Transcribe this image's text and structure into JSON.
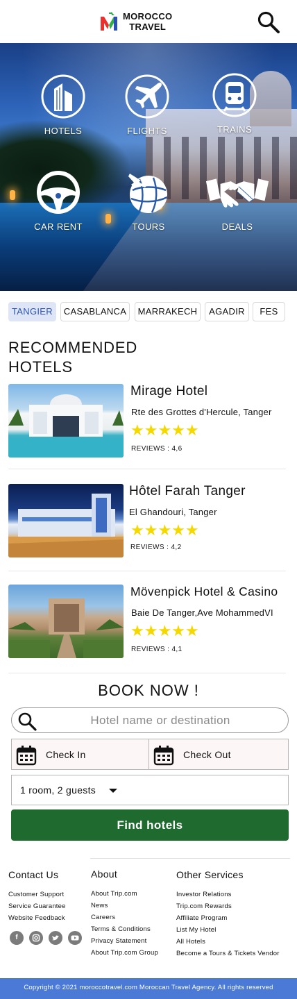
{
  "brand": {
    "name_line1": "MOROCCO",
    "name_line2": "TRAVEL",
    "colors": {
      "red": "#e8322d",
      "green": "#2fae4a",
      "blue": "#2b4fb5"
    }
  },
  "header": {
    "search_icon": "search-icon"
  },
  "categories": [
    {
      "label": "HOTELS",
      "icon": "building-icon"
    },
    {
      "label": "FLIGHTS",
      "icon": "plane-icon"
    },
    {
      "label": "TRAINS",
      "icon": "train-icon"
    },
    {
      "label": "CAR RENT",
      "icon": "steering-wheel-icon"
    },
    {
      "label": "TOURS",
      "icon": "globe-plane-icon"
    },
    {
      "label": "DEALS",
      "icon": "handshake-icon"
    }
  ],
  "cities": [
    {
      "label": "TANGIER",
      "active": true
    },
    {
      "label": "CASABLANCA",
      "active": false
    },
    {
      "label": "MARRAKECH",
      "active": false
    },
    {
      "label": "AGADIR",
      "active": false
    },
    {
      "label": "FES",
      "active": false
    }
  ],
  "section_title": "RECOMMENDED HOTELS",
  "hotels": [
    {
      "name": "Mirage Hotel",
      "address": "Rte des Grottes d'Hercule, Tanger",
      "stars": "★★★★★",
      "rating": 5,
      "reviews_label": "REVIEWS :",
      "reviews_value": "4,6"
    },
    {
      "name": "Hôtel Farah Tanger",
      "address": "El Ghandouri, Tanger",
      "stars": "★★★★★",
      "rating": 5,
      "reviews_label": "REVIEWS :",
      "reviews_value": "4,2"
    },
    {
      "name": "Mövenpick Hotel & Casino",
      "address": "Baie De Tanger,Ave MohammedVI",
      "stars": "★★★★★",
      "rating": 5,
      "reviews_label": "REVIEWS :",
      "reviews_value": "4,1"
    }
  ],
  "booking": {
    "title": "BOOK NOW !",
    "search_placeholder": "Hotel name or destination",
    "check_in": "Check In",
    "check_out": "Check Out",
    "guests": "1 room, 2 guests",
    "find_button": "Find hotels",
    "button_color": "#1f6b2f"
  },
  "footer": {
    "contact": {
      "title": "Contact Us",
      "links": [
        "Customer Support",
        "Service Guarantee",
        "Website Feedback"
      ]
    },
    "about": {
      "title": "About",
      "links": [
        "About Trip.com",
        "News",
        "Careers",
        "Terms & Conditions",
        "Privacy Statement",
        "About Trip.com Group"
      ]
    },
    "other": {
      "title": "Other Services",
      "links": [
        "Investor Relations",
        "Trip.com Rewards",
        "Affiliate Program",
        "List My Hotel",
        "All Hotels",
        "Become a Tours & Tickets Vendor"
      ]
    },
    "social": [
      "facebook-icon",
      "instagram-icon",
      "twitter-icon",
      "youtube-icon"
    ],
    "copyright": "Copyright © 2021 moroccotravel.com Moroccan Travel Agency. All rights reserved",
    "copyright_bg": "#4a7ad6"
  }
}
